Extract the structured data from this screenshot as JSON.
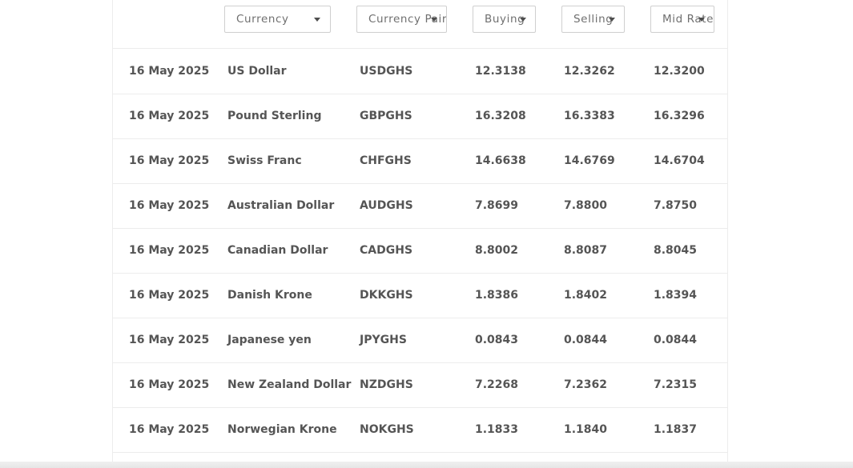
{
  "filters": [
    {
      "label": "Currency",
      "caret_icon": "chevron-down-icon"
    },
    {
      "label": "Currency Pair",
      "caret_icon": "chevron-down-icon"
    },
    {
      "label": "Buying",
      "caret_icon": "chevron-down-icon"
    },
    {
      "label": "Selling",
      "caret_icon": "chevron-down-icon"
    },
    {
      "label": "Mid Rate",
      "caret_icon": "chevron-down-icon"
    }
  ],
  "rows": [
    {
      "date": "16 May 2025",
      "currency": "US Dollar",
      "pair": "USDGHS",
      "buying": "12.3138",
      "selling": "12.3262",
      "mid": "12.3200"
    },
    {
      "date": "16 May 2025",
      "currency": "Pound Sterling",
      "pair": "GBPGHS",
      "buying": "16.3208",
      "selling": "16.3383",
      "mid": "16.3296"
    },
    {
      "date": "16 May 2025",
      "currency": "Swiss Franc",
      "pair": "CHFGHS",
      "buying": "14.6638",
      "selling": "14.6769",
      "mid": "14.6704"
    },
    {
      "date": "16 May 2025",
      "currency": "Australian Dollar",
      "pair": "AUDGHS",
      "buying": "7.8699",
      "selling": "7.8800",
      "mid": "7.8750"
    },
    {
      "date": "16 May 2025",
      "currency": "Canadian Dollar",
      "pair": "CADGHS",
      "buying": "8.8002",
      "selling": "8.8087",
      "mid": "8.8045"
    },
    {
      "date": "16 May 2025",
      "currency": "Danish Krone",
      "pair": "DKKGHS",
      "buying": "1.8386",
      "selling": "1.8402",
      "mid": "1.8394"
    },
    {
      "date": "16 May 2025",
      "currency": "Japanese yen",
      "pair": "JPYGHS",
      "buying": "0.0843",
      "selling": "0.0844",
      "mid": "0.0844"
    },
    {
      "date": "16 May 2025",
      "currency": "New Zealand Dollar",
      "pair": "NZDGHS",
      "buying": "7.2268",
      "selling": "7.2362",
      "mid": "7.2315"
    },
    {
      "date": "16 May 2025",
      "currency": "Norwegian Krone",
      "pair": "NOKGHS",
      "buying": "1.1833",
      "selling": "1.1840",
      "mid": "1.1837"
    }
  ]
}
